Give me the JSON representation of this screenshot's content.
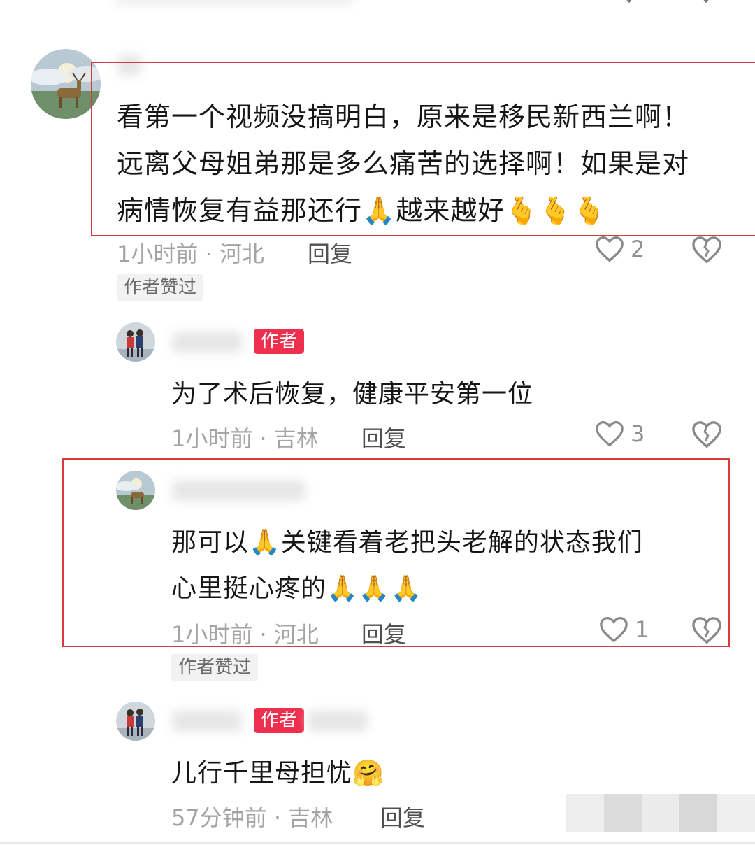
{
  "comments": [
    {
      "text_lines": [
        "看第一个视频没搞明白，原来是移民新西兰啊！",
        "远离父母姐弟那是多么痛苦的选择啊！如果是对",
        "病情恢复有益那还行🙏越来越好🫰🫰🫰"
      ],
      "meta": "1小时前 · 河北",
      "reply": "回复",
      "likes": "2",
      "liked_by_author": "作者赞过"
    },
    {
      "author_tag": "作者",
      "text": "为了术后恢复，健康平安第一位",
      "meta": "1小时前 · 吉林",
      "reply": "回复",
      "likes": "3"
    },
    {
      "text_lines": [
        "那可以🙏关键看着老把头老解的状态我们",
        "心里挺心疼的🙏🙏🙏"
      ],
      "meta": "1小时前 · 河北",
      "reply": "回复",
      "likes": "1",
      "liked_by_author": "作者赞过"
    },
    {
      "author_tag": "作者",
      "text": "儿行千里母担忧🤗",
      "meta": "57分钟前 · 吉林",
      "reply": "回复"
    }
  ],
  "colors": {
    "highlight_border": "#d63a3a",
    "author_tag": "#ee2f4e"
  },
  "icons": [
    "heart-icon",
    "dislike-broken-heart-icon",
    "deer-avatar",
    "family-avatar"
  ]
}
